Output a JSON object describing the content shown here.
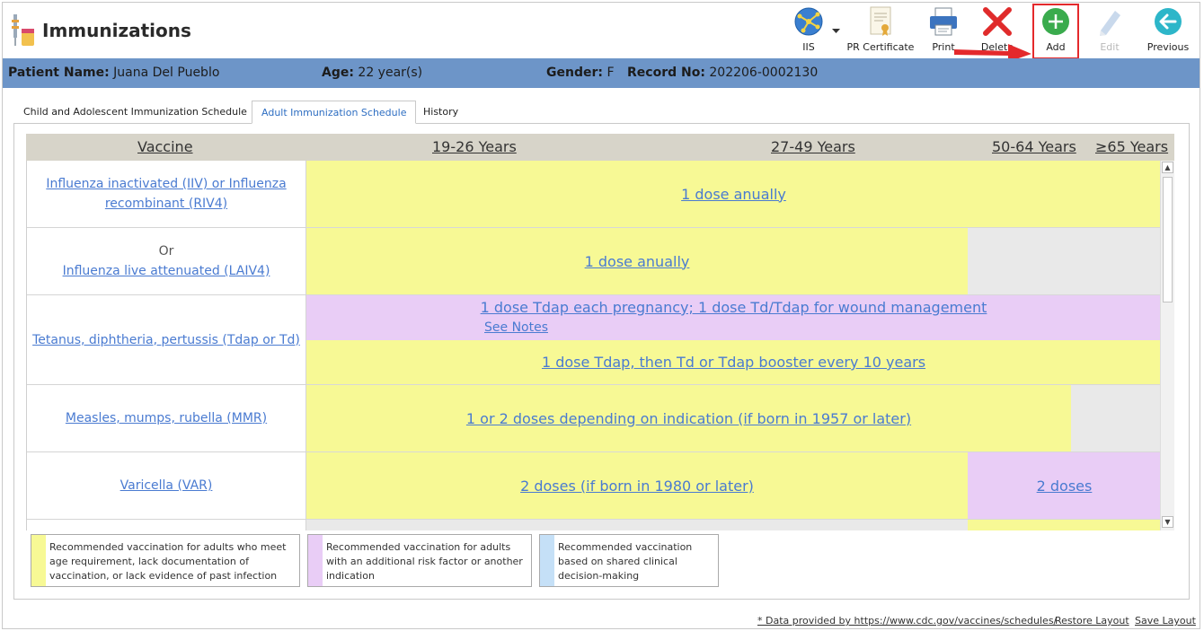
{
  "header": {
    "title": "Immunizations",
    "app_icon": "immunizations-icon"
  },
  "toolbar": {
    "iis_label": "IIS",
    "pr_certificate_label": "PR Certificate",
    "print_label": "Print",
    "delete_label": "Delete",
    "add_label": "Add",
    "edit_label": "Edit",
    "previous_label": "Previous",
    "accent_add": "#3aab4d",
    "accent_delete": "#e02b2b",
    "accent_previous": "#2db6c9"
  },
  "patient": {
    "name_label": "Patient Name:",
    "name_value": "Juana Del Pueblo",
    "age_label": "Age:",
    "age_value": "22 year(s)",
    "gender_label": "Gender:",
    "gender_value": "F",
    "record_label": "Record No:",
    "record_value": "202206-0002130"
  },
  "tabs": [
    {
      "label": "Child and Adolescent Immunization Schedule",
      "active": false
    },
    {
      "label": "Adult Immunization Schedule",
      "active": true
    },
    {
      "label": "History",
      "active": false
    }
  ],
  "schedule": {
    "columns": [
      "Vaccine",
      "19-26 Years",
      "27-49 Years",
      "50-64 Years",
      "≥65 Years"
    ],
    "rows": {
      "influenza_inactivated": {
        "vaccine": "Influenza inactivated (IIV) or Influenza recombinant (RIV4)",
        "dose": "1 dose anually"
      },
      "influenza_live": {
        "or": "Or",
        "vaccine": "Influenza live attenuated (LAIV4)",
        "dose": "1 dose anually"
      },
      "tdap": {
        "vaccine": "Tetanus, diphtheria, pertussis (Tdap or Td)",
        "dose_violet": "1 dose Tdap each pregnancy; 1 dose Td/Tdap for wound management",
        "notes": "See Notes",
        "dose_yellow": "1 dose Tdap, then Td or Tdap booster every 10 years"
      },
      "mmr": {
        "vaccine": "Measles, mumps, rubella (MMR)",
        "dose": "1 or 2 doses depending on indication (if born in 1957 or later)"
      },
      "varicella": {
        "vaccine": "Varicella (VAR)",
        "dose_yellow": "2 doses (if born in 1980 or later)",
        "dose_violet": "2 doses"
      }
    },
    "colors": {
      "yellow": "#f7f995",
      "violet": "#e9cdf6",
      "blue": "#c5e0f7",
      "grey": "#e9e9e9"
    }
  },
  "legend": [
    {
      "text": "Recommended vaccination for adults who meet age requirement, lack documentation of vaccination, or lack evidence of past infection",
      "color": "#f7f995"
    },
    {
      "text": "Recommended vaccination for adults with an additional risk factor or another indication",
      "color": "#e9cdf6"
    },
    {
      "text": "Recommended vaccination based on shared clinical decision-making",
      "color": "#c5e0f7"
    }
  ],
  "footer": {
    "data_source": "* Data provided by https://www.cdc.gov/vaccines/schedules/",
    "restore_layout": "Restore Layout",
    "save_layout": "Save Layout"
  }
}
